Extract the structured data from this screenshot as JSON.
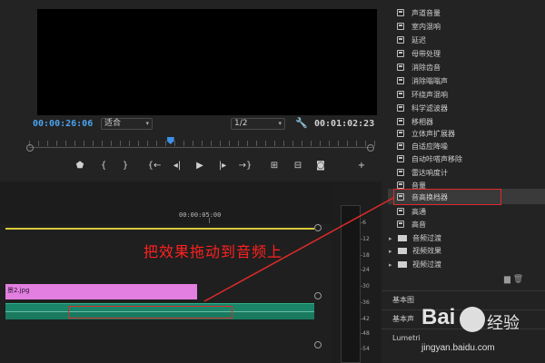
{
  "program_monitor": {
    "timecode_current": "00:00:26:06",
    "fit_select": "适合",
    "resolution_select": "1/2",
    "timecode_duration": "00:01:02:23",
    "playhead_fraction": 0.41,
    "transport_buttons": [
      "marker",
      "in-point",
      "out-point",
      "go-to-in",
      "step-back",
      "play",
      "step-forward",
      "go-to-out",
      "lift",
      "extract",
      "export-frame",
      "add"
    ]
  },
  "timeline": {
    "ruler_timecode": "00:00:05:00",
    "video_clip_label": "景2.jpg",
    "audio_track_color": "#1a8569",
    "video_clip_color": "#e27fe0"
  },
  "audio_meter": {
    "labels": [
      "-6",
      "-12",
      "-18",
      "-24",
      "-30",
      "-36",
      "-42",
      "-48",
      "-54"
    ]
  },
  "effects": {
    "items": [
      "声道音量",
      "室内混响",
      "延迟",
      "母带处理",
      "消除齿音",
      "消除嗡嗡声",
      "环绕声混响",
      "科学滤波器",
      "移相器",
      "立体声扩展器",
      "自适应降噪",
      "自动咔嗒声移除",
      "雷达响度计",
      "音量",
      "音高换档器",
      "高通",
      "高音"
    ],
    "selected_item": "音高换档器",
    "folders": [
      "音频过渡",
      "视频效果",
      "视频过渡"
    ]
  },
  "essential_sound": {
    "rows": [
      "基本图",
      "基本声",
      "Lumetri"
    ]
  },
  "annotation": {
    "instruction_text": "把效果拖动到音频上",
    "color": "#ff2020"
  },
  "watermark": {
    "brand": "Bai",
    "brand_du": "du",
    "jingyan": "经验",
    "url": "jingyan.baidu.com"
  }
}
